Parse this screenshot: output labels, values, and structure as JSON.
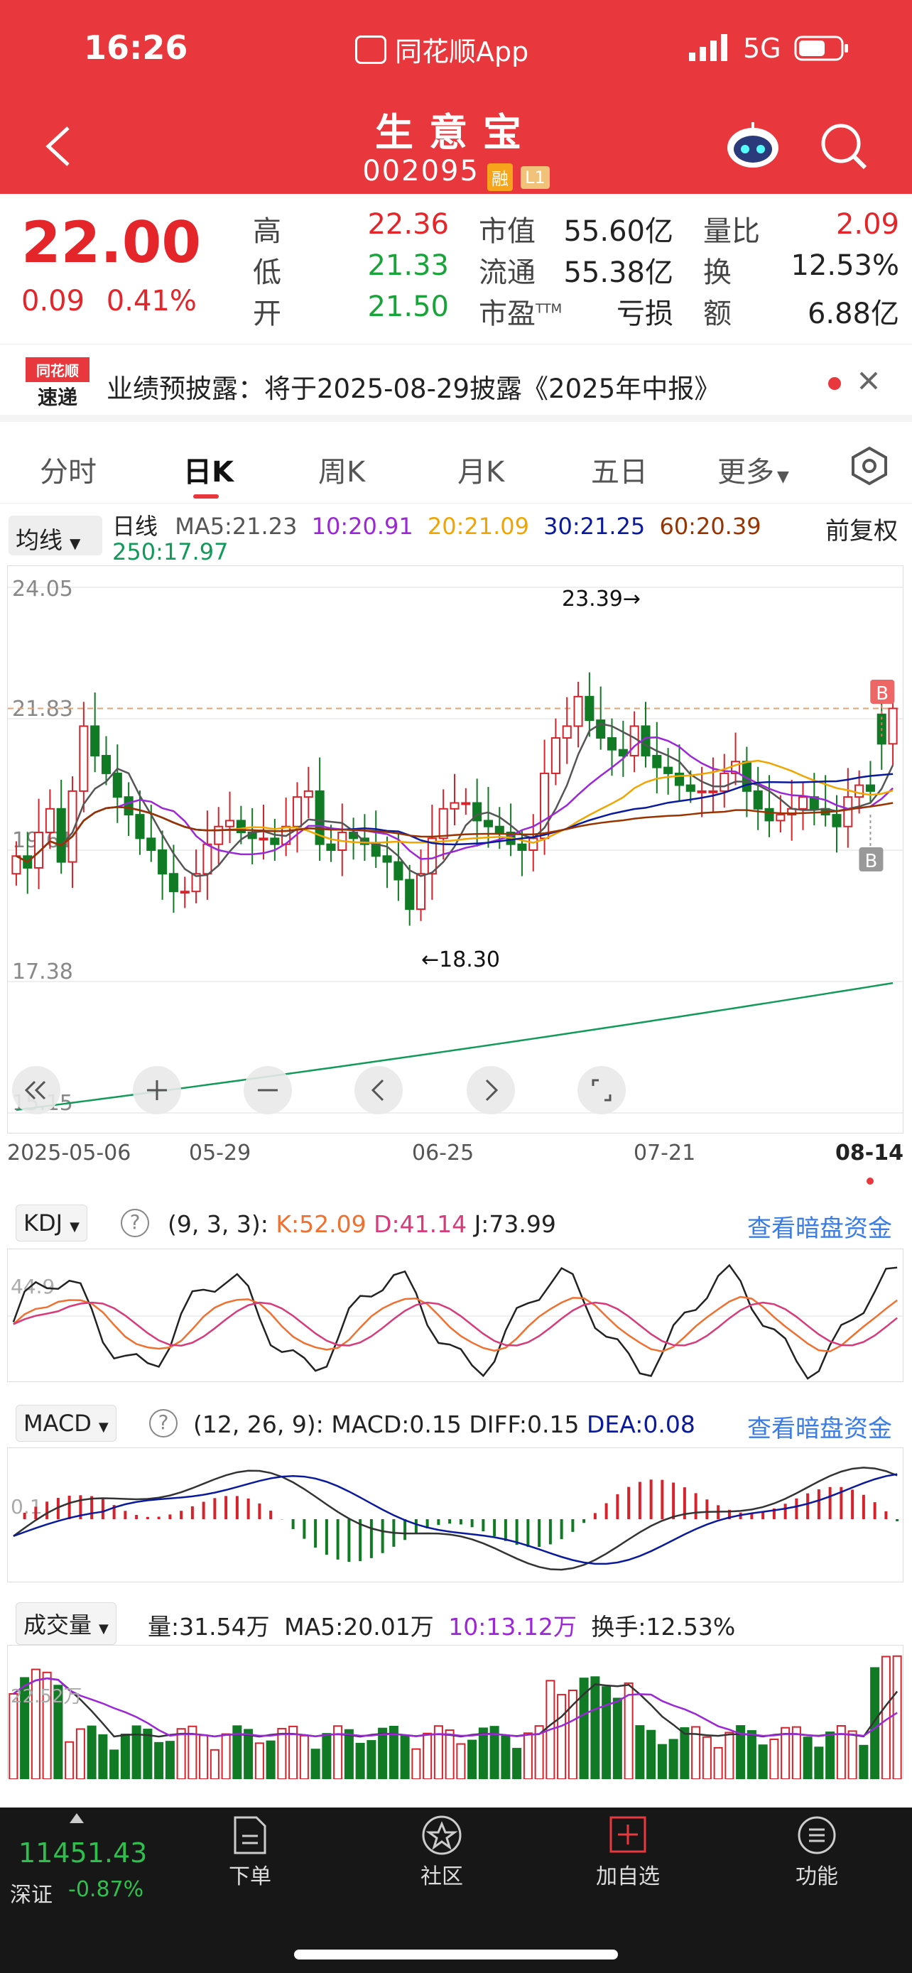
{
  "status_bar": {
    "time": "16:26",
    "app_name": "同花顺App",
    "network": "5G"
  },
  "header": {
    "stock_name": "生意宝",
    "stock_code": "002095",
    "badges": [
      "融",
      "L1"
    ],
    "back_icon": "back-arrow-icon",
    "robot_icon": "robot-assistant-icon",
    "search_icon": "search-icon"
  },
  "quote": {
    "price": "22.00",
    "change": "0.09",
    "change_pct": "0.41%",
    "col1": [
      {
        "label": "高",
        "value": "22.36",
        "color": "red"
      },
      {
        "label": "低",
        "value": "21.33",
        "color": "green"
      },
      {
        "label": "开",
        "value": "21.50",
        "color": "green"
      }
    ],
    "col2": [
      {
        "label": "市值",
        "value": "55.60亿"
      },
      {
        "label": "流通",
        "value": "55.38亿"
      },
      {
        "label": "市盈",
        "sup": "TTM",
        "value": "亏损"
      }
    ],
    "col3": [
      {
        "label": "量比",
        "value": "2.09",
        "color": "red"
      },
      {
        "label": "换",
        "value": "12.53%"
      },
      {
        "label": "额",
        "value": "6.88亿"
      }
    ]
  },
  "notice": {
    "logo_top": "同花顺",
    "logo_bottom": "速递",
    "text": "业绩预披露：将于2025-08-29披露《2025年中报》"
  },
  "tabs": [
    {
      "label": "分时",
      "active": false
    },
    {
      "label": "日K",
      "active": true
    },
    {
      "label": "周K",
      "active": false
    },
    {
      "label": "月K",
      "active": false
    },
    {
      "label": "五日",
      "active": false
    },
    {
      "label": "更多",
      "active": false
    }
  ],
  "ma": {
    "selector": "均线",
    "period": "日线",
    "ma5": "MA5:21.23",
    "ma10": "10:20.91",
    "ma20": "20:21.09",
    "ma30": "30:21.25",
    "ma60": "60:20.39",
    "ma250": "250:17.97",
    "adjust": "前复权",
    "colors": {
      "ma5": "#555555",
      "ma10": "#9b27d9",
      "ma20": "#f0a500",
      "ma30": "#0a1a9c",
      "ma60": "#993300",
      "ma250": "#119a5a"
    }
  },
  "chart_data": [
    {
      "type": "candlestick",
      "y_axis_labels": [
        "24.05",
        "21.83",
        "19.61",
        "17.38",
        "15.15"
      ],
      "ylim": [
        15.15,
        24.05
      ],
      "x_axis_labels": [
        "2025-05-06",
        "05-29",
        "06-25",
        "07-21",
        "08-14"
      ],
      "annotations": [
        "23.39→",
        "←18.30"
      ],
      "markers": [
        "B",
        "B"
      ],
      "last_close": 22.0,
      "closes": [
        19.5,
        19.3,
        19.9,
        20.3,
        19.4,
        20.6,
        21.7,
        21.2,
        20.9,
        20.5,
        20.2,
        19.8,
        19.6,
        19.2,
        18.9,
        18.9,
        19.2,
        19.7,
        20.0,
        20.1,
        19.9,
        19.8,
        19.8,
        19.7,
        20.0,
        20.5,
        20.6,
        19.7,
        19.6,
        19.9,
        19.8,
        19.7,
        19.5,
        19.4,
        19.1,
        18.6,
        19.2,
        19.8,
        20.3,
        20.4,
        20.4,
        20.1,
        20.0,
        19.9,
        19.7,
        19.6,
        19.8,
        20.9,
        21.5,
        21.7,
        22.2,
        21.8,
        21.5,
        21.3,
        21.2,
        21.7,
        21.2,
        21.0,
        20.9,
        20.7,
        20.6,
        20.6,
        20.6,
        20.9,
        21.1,
        20.6,
        20.3,
        20.1,
        20.2,
        20.3,
        20.5,
        20.3,
        20.2,
        20.0,
        20.5,
        20.7,
        20.6,
        21.4,
        22.0
      ],
      "opens": [
        19.2,
        19.5,
        19.3,
        19.9,
        20.3,
        19.4,
        20.6,
        21.7,
        21.2,
        20.9,
        20.5,
        20.2,
        19.8,
        19.6,
        19.2,
        18.9,
        18.9,
        19.2,
        19.7,
        20.0,
        20.1,
        19.9,
        19.8,
        19.8,
        19.7,
        20.0,
        20.5,
        20.6,
        19.7,
        19.6,
        19.9,
        19.8,
        19.7,
        19.5,
        19.4,
        19.1,
        18.6,
        19.2,
        19.8,
        20.3,
        20.4,
        20.4,
        20.1,
        20.0,
        19.9,
        19.7,
        19.6,
        19.8,
        20.9,
        21.5,
        21.7,
        22.2,
        21.8,
        21.5,
        21.3,
        21.2,
        21.7,
        21.2,
        21.0,
        20.9,
        20.7,
        20.6,
        20.6,
        20.6,
        20.9,
        21.1,
        20.6,
        20.3,
        20.1,
        20.2,
        20.3,
        20.5,
        20.3,
        20.2,
        20.0,
        20.5,
        20.7,
        21.9,
        21.4
      ]
    },
    {
      "type": "line",
      "name": "KDJ",
      "params": "(9, 3, 3):",
      "k_label": "K:52.09",
      "d_label": "D:41.14",
      "j_label": "J:73.99",
      "axis_label": "44.9"
    },
    {
      "type": "bar",
      "name": "MACD",
      "params": "(12, 26, 9):",
      "macd_label": "MACD:0.15",
      "diff_label": "DIFF:0.15",
      "dea_label": "DEA:0.08",
      "axis_label": "0.1"
    },
    {
      "type": "bar",
      "name": "成交量",
      "vol_label": "量:31.54万",
      "ma5_label": "MA5:20.01万",
      "ma10_label": "10:13.12万",
      "turnover_label": "换手:12.53%",
      "axis_label": "22.52万"
    }
  ],
  "link_text": "查看暗盘资金",
  "chart_controls": [
    "rewind-icon",
    "zoom-in-icon",
    "zoom-out-icon",
    "prev-icon",
    "next-icon",
    "fullscreen-icon"
  ],
  "bottom_bar": {
    "index_value": "11451.43",
    "index_name": "深证",
    "index_change": "-0.87%",
    "nav": [
      {
        "label": "下单",
        "icon": "order-icon"
      },
      {
        "label": "社区",
        "icon": "community-icon"
      },
      {
        "label": "加自选",
        "icon": "add-watchlist-icon"
      },
      {
        "label": "功能",
        "icon": "menu-icon"
      }
    ]
  }
}
